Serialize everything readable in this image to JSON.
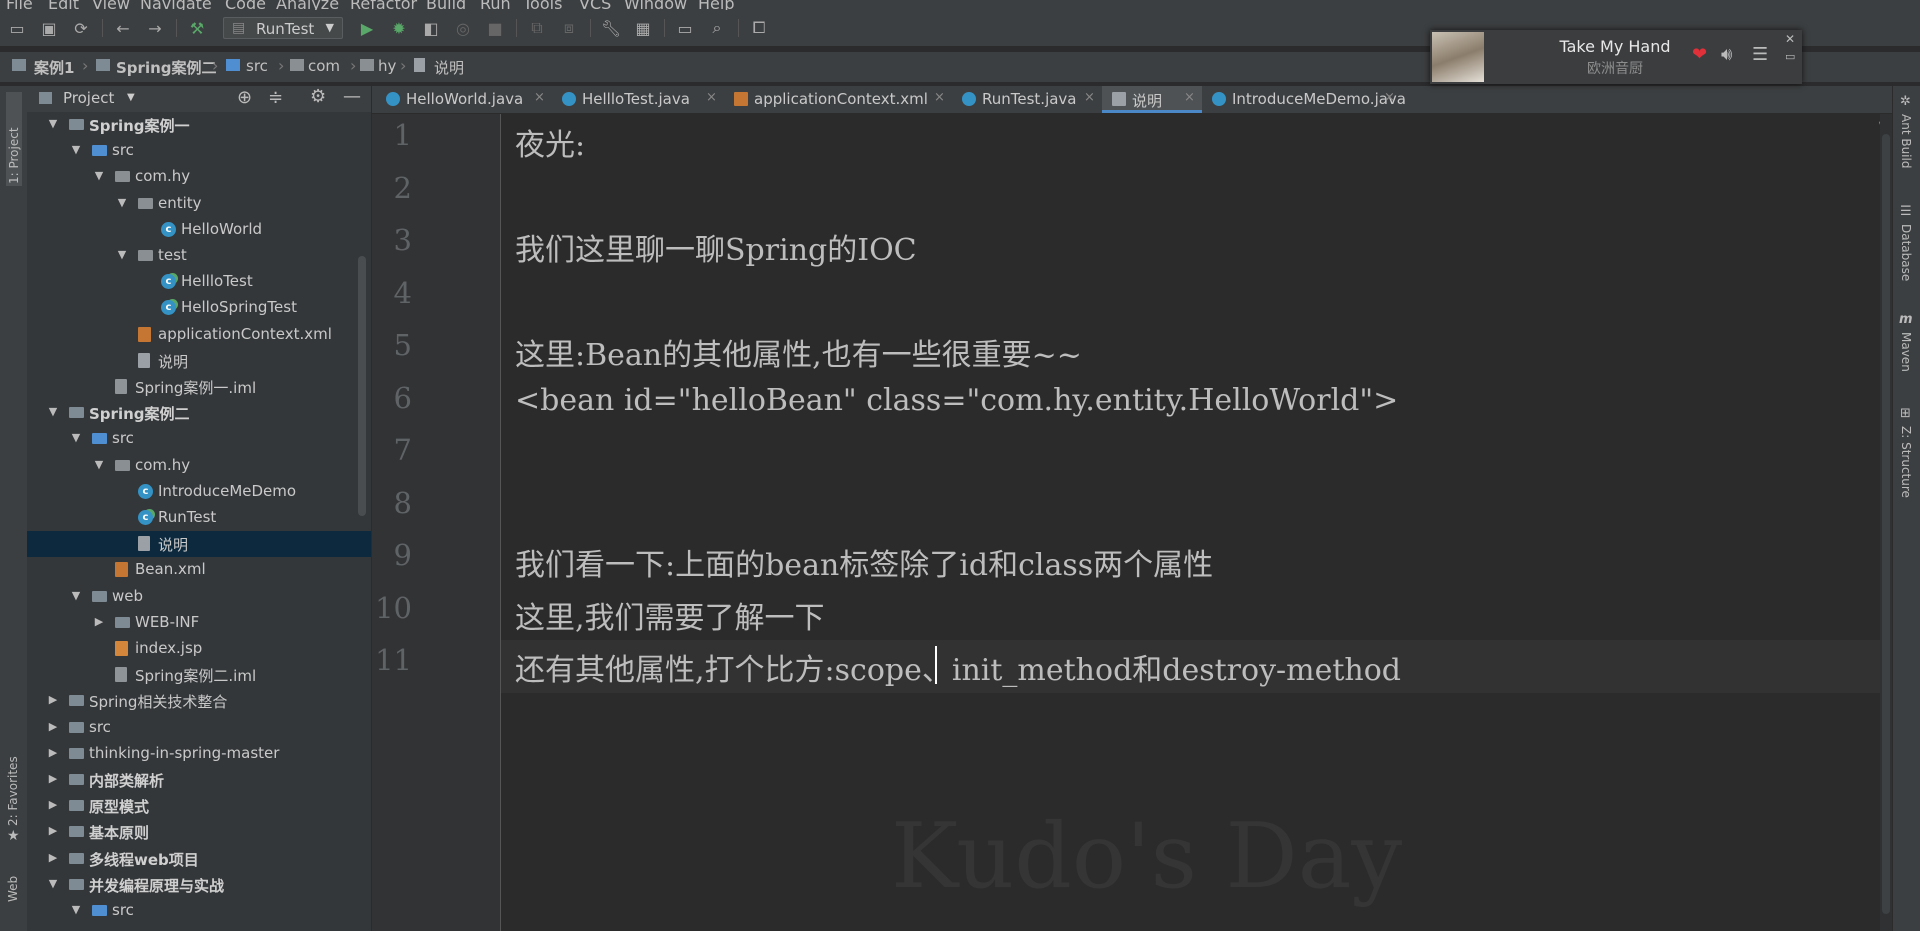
{
  "menu": [
    "File",
    "Edit",
    "View",
    "Navigate",
    "Code",
    "Analyze",
    "Refactor",
    "Build",
    "Run",
    "Tools",
    "VCS",
    "Window",
    "Help"
  ],
  "toolbar": {
    "run_config": "RunTest"
  },
  "breadcrumb": [
    "案例1",
    "Spring案例二",
    "src",
    "com",
    "hy",
    "说明"
  ],
  "left_tabs": {
    "project": "1: Project",
    "favorites": "2: Favorites",
    "web": "Web"
  },
  "right_tabs": [
    "Ant Build",
    "Database",
    "Maven",
    "Z: Structure"
  ],
  "project_panel": {
    "title": "Project",
    "tree": [
      {
        "label": "Spring案例一",
        "depth": 1,
        "icon": "module",
        "arrow": "open",
        "bold": true
      },
      {
        "label": "src",
        "depth": 2,
        "icon": "src",
        "arrow": "open"
      },
      {
        "label": "com.hy",
        "depth": 3,
        "icon": "package",
        "arrow": "open"
      },
      {
        "label": "entity",
        "depth": 4,
        "icon": "package",
        "arrow": "open"
      },
      {
        "label": "HelloWorld",
        "depth": 5,
        "icon": "class"
      },
      {
        "label": "test",
        "depth": 4,
        "icon": "package",
        "arrow": "open"
      },
      {
        "label": "HellloTest",
        "depth": 5,
        "icon": "test"
      },
      {
        "label": "HelloSpringTest",
        "depth": 5,
        "icon": "test"
      },
      {
        "label": "applicationContext.xml",
        "depth": 4,
        "icon": "xml"
      },
      {
        "label": "说明",
        "depth": 4,
        "icon": "file"
      },
      {
        "label": "Spring案例一.iml",
        "depth": 3,
        "icon": "iml"
      },
      {
        "label": "Spring案例二",
        "depth": 1,
        "icon": "module",
        "arrow": "open",
        "bold": true
      },
      {
        "label": "src",
        "depth": 2,
        "icon": "src",
        "arrow": "open"
      },
      {
        "label": "com.hy",
        "depth": 3,
        "icon": "package",
        "arrow": "open"
      },
      {
        "label": "IntroduceMeDemo",
        "depth": 4,
        "icon": "class"
      },
      {
        "label": "RunTest",
        "depth": 4,
        "icon": "test"
      },
      {
        "label": "说明",
        "depth": 4,
        "icon": "file",
        "selected": true
      },
      {
        "label": "Bean.xml",
        "depth": 3,
        "icon": "xml"
      },
      {
        "label": "web",
        "depth": 2,
        "icon": "folder",
        "arrow": "open"
      },
      {
        "label": "WEB-INF",
        "depth": 3,
        "icon": "folder",
        "arrow": "closed"
      },
      {
        "label": "index.jsp",
        "depth": 3,
        "icon": "jsp"
      },
      {
        "label": "Spring案例二.iml",
        "depth": 3,
        "icon": "iml"
      },
      {
        "label": "Spring相关技术整合",
        "depth": 1,
        "icon": "folder",
        "arrow": "closed"
      },
      {
        "label": "src",
        "depth": 1,
        "icon": "folder",
        "arrow": "closed"
      },
      {
        "label": "thinking-in-spring-master",
        "depth": 1,
        "icon": "folder",
        "arrow": "closed"
      },
      {
        "label": "内部类解析",
        "depth": 1,
        "icon": "module",
        "arrow": "closed",
        "bold": true
      },
      {
        "label": "原型模式",
        "depth": 1,
        "icon": "module",
        "arrow": "closed",
        "bold": true
      },
      {
        "label": "基本原则",
        "depth": 1,
        "icon": "module",
        "arrow": "closed",
        "bold": true
      },
      {
        "label": "多线程web项目",
        "depth": 1,
        "icon": "module",
        "arrow": "closed",
        "bold": true
      },
      {
        "label": "并发编程原理与实战",
        "depth": 1,
        "icon": "module",
        "arrow": "open",
        "bold": true
      },
      {
        "label": "src",
        "depth": 2,
        "icon": "src",
        "arrow": "open"
      }
    ]
  },
  "tabs": [
    {
      "label": "HelloWorld.java",
      "icon": "class"
    },
    {
      "label": "HellloTest.java",
      "icon": "test"
    },
    {
      "label": "applicationContext.xml",
      "icon": "xml"
    },
    {
      "label": "RunTest.java",
      "icon": "test"
    },
    {
      "label": "说明",
      "icon": "file",
      "active": true
    },
    {
      "label": "IntroduceMeDemo.java",
      "icon": "class"
    }
  ],
  "editor": {
    "lines": [
      "夜光:",
      "",
      "我们这里聊一聊Spring的IOC",
      "",
      "这里:Bean的其他属性,也有一些很重要~~",
      "<bean id=\"helloBean\" class=\"com.hy.entity.HelloWorld\">",
      "",
      "",
      "我们看一下:上面的bean标签除了id和class两个属性",
      "这里,我们需要了解一下",
      "还有其他属性,打个比方:scope、init_method和destroy-method"
    ],
    "line_numbers": [
      "1",
      "2",
      "3",
      "4",
      "5",
      "6",
      "7",
      "8",
      "9",
      "10",
      "11"
    ],
    "watermark": "Kudo's Day"
  },
  "music": {
    "title": "Take My Hand",
    "artist": "欧洲音厨"
  }
}
